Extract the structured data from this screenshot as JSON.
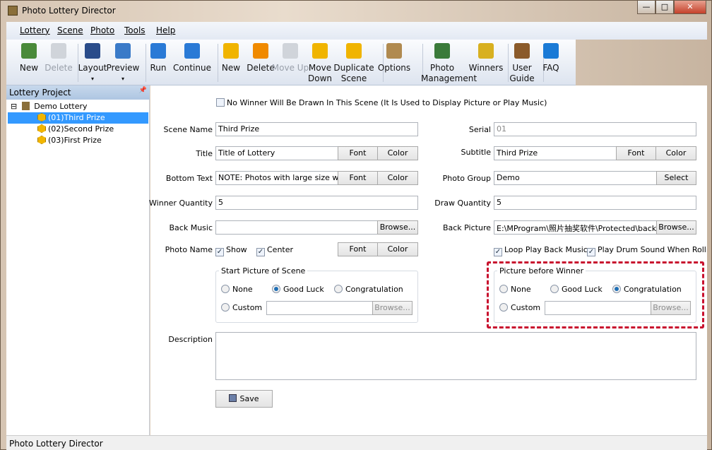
{
  "window": {
    "title": "Photo Lottery Director",
    "minimize": "—",
    "maximize": "□",
    "close": "✕"
  },
  "menu": [
    "Lottery",
    "Scene",
    "Photo",
    "Tools",
    "Help"
  ],
  "toolbar": [
    {
      "label": "New",
      "icon": "new-lottery-icon",
      "disabled": false
    },
    {
      "label": "Delete",
      "icon": "delete-lottery-icon",
      "disabled": true
    },
    {
      "label": "Layout",
      "icon": "layout-icon",
      "disabled": false,
      "dropdown": "▾"
    },
    {
      "label": "Preview",
      "icon": "preview-icon",
      "disabled": false,
      "dropdown": "▾"
    },
    {
      "label": "Run",
      "icon": "run-icon",
      "disabled": false
    },
    {
      "label": "Continue",
      "icon": "continue-icon",
      "disabled": false
    },
    {
      "label": "New",
      "icon": "new-scene-icon",
      "disabled": false
    },
    {
      "label": "Delete",
      "icon": "delete-scene-icon",
      "disabled": false
    },
    {
      "label": "Move Up",
      "icon": "move-up-icon",
      "disabled": true
    },
    {
      "label": "Move Down",
      "icon": "move-down-icon",
      "disabled": false
    },
    {
      "label": "Duplicate Scene",
      "icon": "duplicate-icon",
      "disabled": false
    },
    {
      "label": "Options",
      "icon": "wrench-icon",
      "disabled": false
    },
    {
      "label": "Photo Management",
      "icon": "people-icon",
      "disabled": false
    },
    {
      "label": "Winners",
      "icon": "medal-icon",
      "disabled": false
    },
    {
      "label": "User Guide",
      "icon": "book-icon",
      "disabled": false
    },
    {
      "label": "FAQ",
      "icon": "help-icon",
      "disabled": false
    }
  ],
  "panel": {
    "title": "Lottery Project",
    "pin": "📌",
    "root": "Demo Lottery",
    "expander": "⊟",
    "scenes": [
      "(01)Third Prize",
      "(02)Second Prize",
      "(03)First Prize"
    ],
    "selected": 0
  },
  "form": {
    "no_winner": {
      "label": "No Winner Will Be Drawn In This Scene  (It Is Used to Display Picture or Play Music)",
      "checked": false
    },
    "scene_name": {
      "label": "Scene Name",
      "value": "Third Prize"
    },
    "serial": {
      "label": "Serial",
      "value": "01"
    },
    "title": {
      "label": "Title",
      "value": "Title of Lottery"
    },
    "subtitle": {
      "label": "Subtitle",
      "value": "Third Prize"
    },
    "bottom_text": {
      "label": "Bottom Text",
      "value": "NOTE: Photos with large size will ma"
    },
    "photo_group": {
      "label": "Photo Group",
      "value": "Demo"
    },
    "winner_quantity": {
      "label": "Winner Quantity",
      "value": "5"
    },
    "draw_quantity": {
      "label": "Draw Quantity",
      "value": "5"
    },
    "back_music": {
      "label": "Back Music",
      "value": ""
    },
    "back_picture": {
      "label": "Back Picture",
      "value": "E:\\MProgram\\照片抽奖软件\\Protected\\back.jp"
    },
    "photo_name": {
      "label": "Photo Name",
      "show": "Show",
      "center": "Center"
    },
    "loop_music": "Loop Play Back Music",
    "drum_sound": "Play Drum Sound When Rolling P",
    "font": "Font",
    "color": "Color",
    "browse": "Browse...",
    "select": "Select",
    "start_picture": {
      "title": "Start Picture of Scene",
      "options": [
        "None",
        "Good Luck",
        "Congratulation",
        "Custom"
      ],
      "selected": "Good Luck"
    },
    "picture_before_winner": {
      "title": "Picture before Winner",
      "options": [
        "None",
        "Good Luck",
        "Congratulation",
        "Custom"
      ],
      "selected": "Congratulation"
    },
    "description": {
      "label": "Description",
      "value": ""
    },
    "save": "Save",
    "check": "✓"
  },
  "status": "Photo Lottery Director",
  "colors": {
    "highlight": "#c8102e",
    "selection": "#3399ff"
  }
}
